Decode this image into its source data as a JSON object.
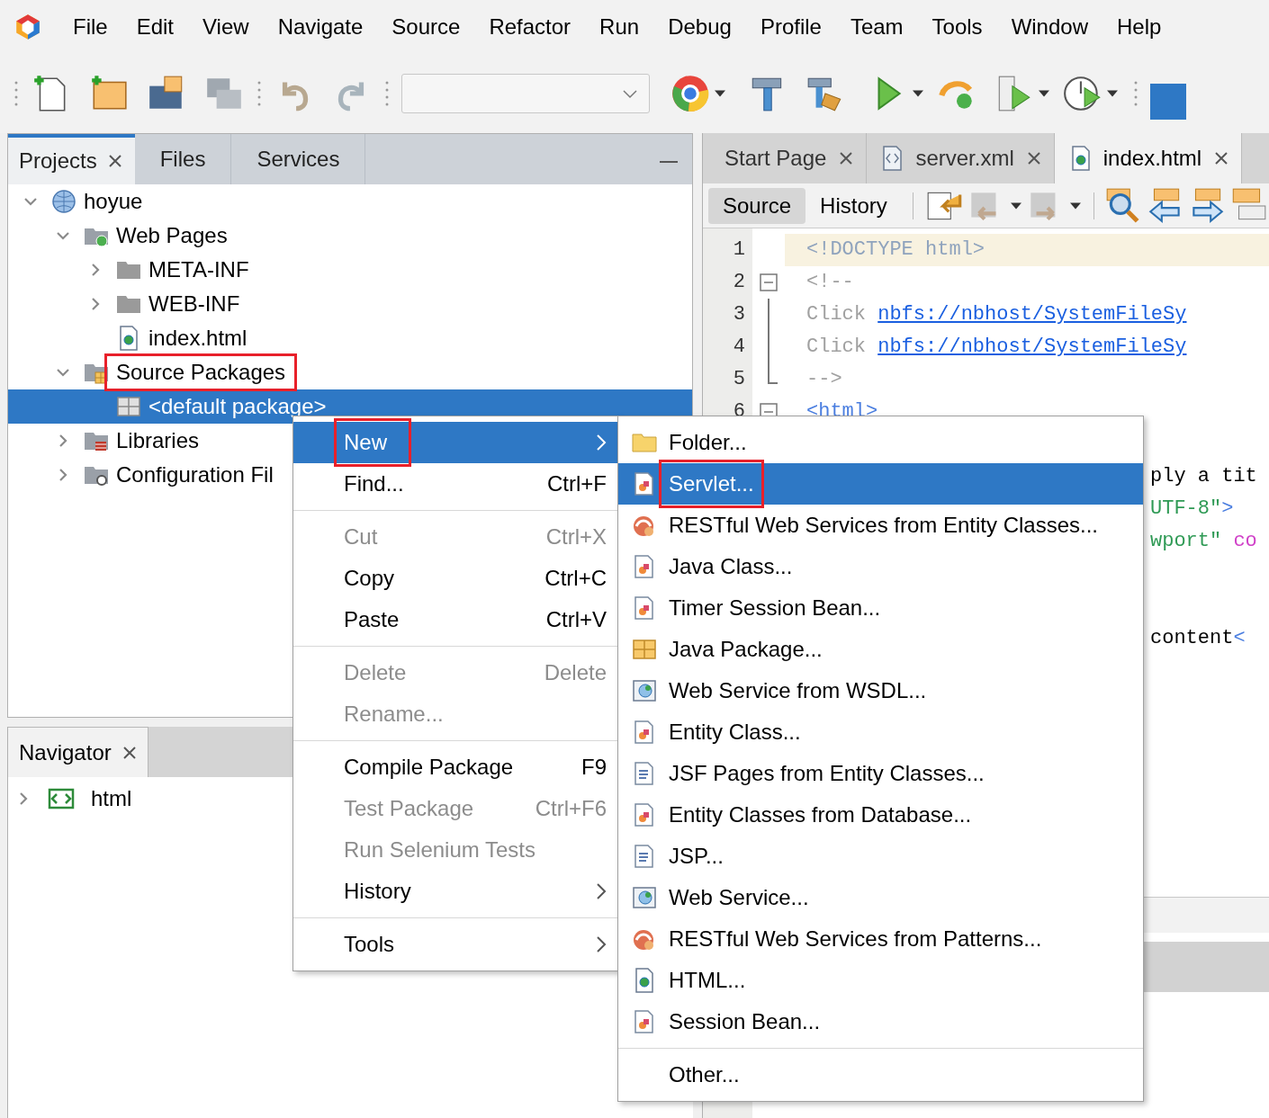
{
  "menu_bar": [
    "File",
    "Edit",
    "View",
    "Navigate",
    "Source",
    "Refactor",
    "Run",
    "Debug",
    "Profile",
    "Team",
    "Tools",
    "Window",
    "Help"
  ],
  "projects_panel": {
    "tabs": [
      {
        "label": "Projects",
        "selected": true,
        "closable": true
      },
      {
        "label": "Files",
        "selected": false,
        "closable": false
      },
      {
        "label": "Services",
        "selected": false,
        "closable": false
      }
    ],
    "tree": [
      {
        "label": "hoyue",
        "expanded": true,
        "selected": false,
        "highlighted": false,
        "children": [
          {
            "label": "Web Pages",
            "expanded": true,
            "selected": false,
            "highlighted": false,
            "children": [
              {
                "label": "META-INF",
                "expanded": false,
                "selected": false,
                "highlighted": false
              },
              {
                "label": "WEB-INF",
                "expanded": false,
                "selected": false,
                "highlighted": false
              },
              {
                "label": "index.html",
                "selected": false,
                "highlighted": false
              }
            ]
          },
          {
            "label": "Source Packages",
            "expanded": true,
            "selected": false,
            "highlighted": true,
            "children": [
              {
                "label": "<default package>",
                "selected": true,
                "highlighted": false
              }
            ]
          },
          {
            "label": "Libraries",
            "expanded": false,
            "selected": false,
            "highlighted": false
          },
          {
            "label": "Configuration Fil",
            "expanded": false,
            "selected": false,
            "highlighted": false
          }
        ]
      }
    ]
  },
  "navigator_panel": {
    "tab": {
      "label": "Navigator",
      "selected": true
    },
    "tree": [
      {
        "label": "html",
        "expanded": false
      }
    ]
  },
  "editor": {
    "tabs": [
      {
        "label": "Start Page",
        "selected": false
      },
      {
        "label": "server.xml",
        "selected": false
      },
      {
        "label": "index.html",
        "selected": true
      }
    ],
    "views": [
      {
        "label": "Source",
        "selected": true
      },
      {
        "label": "History",
        "selected": false
      }
    ],
    "lines": [
      {
        "number": "1",
        "kind": "plain",
        "highlighted": true,
        "tokens": [
          {
            "kind": "doctype",
            "text": "<!DOCTYPE html>"
          }
        ]
      },
      {
        "number": "2",
        "kind": "fold_start",
        "highlighted": false,
        "tokens": [
          {
            "kind": "comment",
            "text": "<!--"
          }
        ]
      },
      {
        "number": "3",
        "kind": "fold_body",
        "highlighted": false,
        "tokens": [
          {
            "kind": "comment",
            "text": "Click "
          },
          {
            "kind": "link",
            "text": "nbfs://nbhost/SystemFileSy"
          }
        ]
      },
      {
        "number": "4",
        "kind": "fold_body",
        "highlighted": false,
        "tokens": [
          {
            "kind": "comment",
            "text": "Click "
          },
          {
            "kind": "link",
            "text": "nbfs://nbhost/SystemFileSy"
          }
        ]
      },
      {
        "number": "5",
        "kind": "fold_end",
        "highlighted": false,
        "tokens": [
          {
            "kind": "comment",
            "text": "-->"
          }
        ]
      },
      {
        "number": "6",
        "kind": "fold_start",
        "highlighted": false,
        "tokens": [
          {
            "kind": "tag",
            "text": "<html>"
          }
        ]
      }
    ],
    "fragments": [
      [
        {
          "kind": "text",
          "text": "ply a tit"
        }
      ],
      [
        {
          "kind": "string",
          "text": "UTF-8\""
        },
        {
          "kind": "tag",
          "text": ">"
        }
      ],
      [
        {
          "kind": "string",
          "text": "wport\""
        },
        {
          "kind": "attribute",
          "text": " co"
        }
      ],
      [
        {
          "kind": "text",
          "text": "content"
        },
        {
          "kind": "tag",
          "text": "<"
        }
      ]
    ]
  },
  "context_menu": {
    "sections": [
      [
        {
          "label": "New",
          "submenu": true,
          "selected": true,
          "disabled": false,
          "highlighted": true
        },
        {
          "label": "Find...",
          "shortcut": "Ctrl+F",
          "selected": false,
          "disabled": false,
          "highlighted": false
        }
      ],
      [
        {
          "label": "Cut",
          "shortcut": "Ctrl+X",
          "selected": false,
          "disabled": true,
          "highlighted": false
        },
        {
          "label": "Copy",
          "shortcut": "Ctrl+C",
          "selected": false,
          "disabled": false,
          "highlighted": false
        },
        {
          "label": "Paste",
          "shortcut": "Ctrl+V",
          "selected": false,
          "disabled": false,
          "highlighted": false
        }
      ],
      [
        {
          "label": "Delete",
          "shortcut": "Delete",
          "selected": false,
          "disabled": true,
          "highlighted": false
        },
        {
          "label": "Rename...",
          "selected": false,
          "disabled": true,
          "highlighted": false
        }
      ],
      [
        {
          "label": "Compile Package",
          "shortcut": "F9",
          "selected": false,
          "disabled": false,
          "highlighted": false
        },
        {
          "label": "Test Package",
          "shortcut": "Ctrl+F6",
          "selected": false,
          "disabled": true,
          "highlighted": false
        },
        {
          "label": "Run Selenium Tests",
          "selected": false,
          "disabled": true,
          "highlighted": false
        },
        {
          "label": "History",
          "submenu": true,
          "selected": false,
          "disabled": false,
          "highlighted": false
        }
      ],
      [
        {
          "label": "Tools",
          "submenu": true,
          "selected": false,
          "disabled": false,
          "highlighted": false
        }
      ]
    ]
  },
  "submenu": {
    "sections": [
      [
        {
          "label": "Folder...",
          "selected": false,
          "highlighted": false
        },
        {
          "label": "Servlet...",
          "selected": true,
          "highlighted": true
        },
        {
          "label": "RESTful Web Services from Entity Classes...",
          "selected": false,
          "highlighted": false
        },
        {
          "label": "Java Class...",
          "selected": false,
          "highlighted": false
        },
        {
          "label": "Timer Session Bean...",
          "selected": false,
          "highlighted": false
        },
        {
          "label": "Java Package...",
          "selected": false,
          "highlighted": false
        },
        {
          "label": "Web Service from WSDL...",
          "selected": false,
          "highlighted": false
        },
        {
          "label": "Entity Class...",
          "selected": false,
          "highlighted": false
        },
        {
          "label": "JSF Pages from Entity Classes...",
          "selected": false,
          "highlighted": false
        },
        {
          "label": "Entity Classes from Database...",
          "selected": false,
          "highlighted": false
        },
        {
          "label": "JSP...",
          "selected": false,
          "highlighted": false
        },
        {
          "label": "Web Service...",
          "selected": false,
          "highlighted": false
        },
        {
          "label": "RESTful Web Services from Patterns...",
          "selected": false,
          "highlighted": false
        },
        {
          "label": "HTML...",
          "selected": false,
          "highlighted": false
        },
        {
          "label": "Session Bean...",
          "selected": false,
          "highlighted": false
        }
      ],
      [
        {
          "label": "Other...",
          "selected": false,
          "highlighted": false
        }
      ]
    ]
  }
}
